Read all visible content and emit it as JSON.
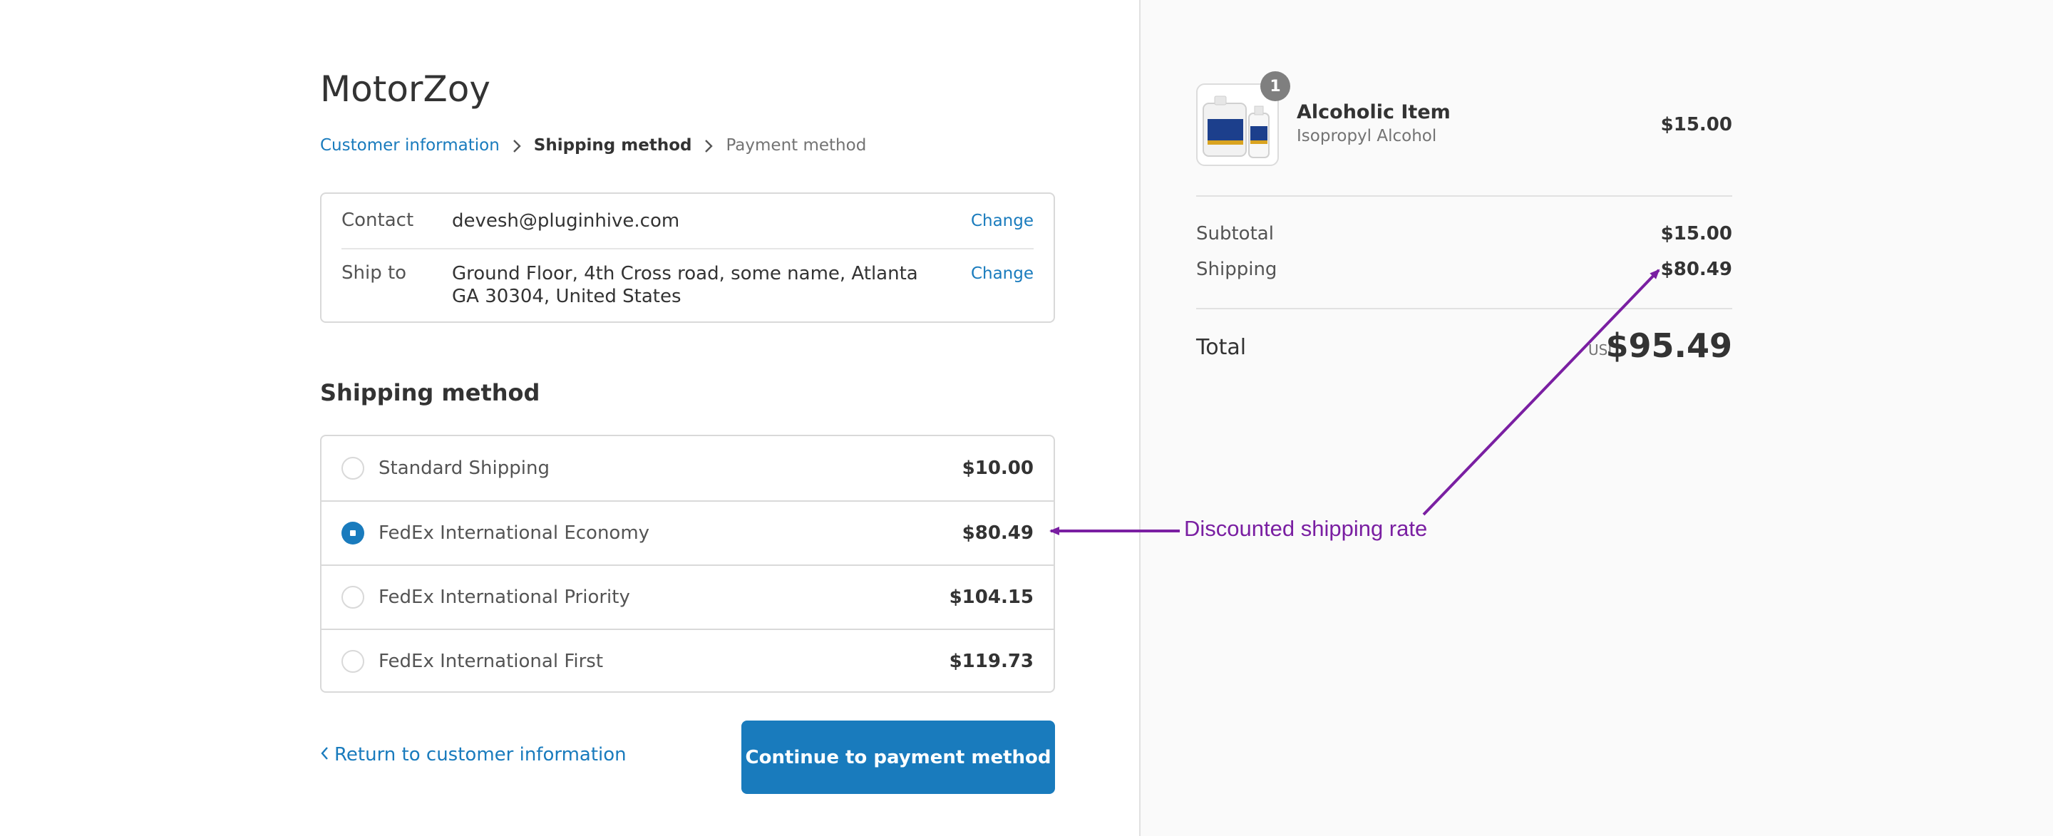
{
  "shop": {
    "name": "MotorZoy"
  },
  "breadcrumb": {
    "items": [
      {
        "label": "Customer information"
      },
      {
        "label": "Shipping method"
      },
      {
        "label": "Payment method"
      }
    ]
  },
  "review": {
    "contact": {
      "label": "Contact",
      "value": "devesh@pluginhive.com",
      "change": "Change"
    },
    "ship_to": {
      "label": "Ship to",
      "value": "Ground Floor, 4th Cross road, some name, Atlanta GA 30304, United States",
      "change": "Change"
    }
  },
  "shipping": {
    "title": "Shipping method",
    "options": [
      {
        "name": "Standard Shipping",
        "price": "$10.00",
        "selected": false
      },
      {
        "name": "FedEx International Economy",
        "price": "$80.49",
        "selected": true
      },
      {
        "name": "FedEx International Priority",
        "price": "$104.15",
        "selected": false
      },
      {
        "name": "FedEx International First",
        "price": "$119.73",
        "selected": false
      }
    ]
  },
  "actions": {
    "return_label": "Return to customer information",
    "continue_label": "Continue to payment method"
  },
  "order": {
    "item": {
      "name": "Alcoholic Item",
      "variant": "Isopropyl Alcohol",
      "price": "$15.00",
      "quantity": "1"
    },
    "subtotal_label": "Subtotal",
    "subtotal_value": "$15.00",
    "shipping_label": "Shipping",
    "shipping_value": "$80.49",
    "total_label": "Total",
    "currency": "USD",
    "total_value": "$95.49"
  },
  "annotation": {
    "text": "Discounted shipping rate",
    "color": "#7a1fa2"
  },
  "colors": {
    "accent": "#197bbd",
    "text": "#333333",
    "sidebar_bg": "#fafafa"
  }
}
